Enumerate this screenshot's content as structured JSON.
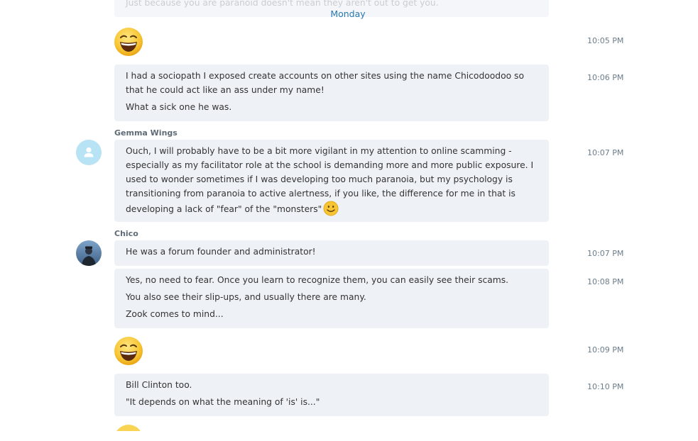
{
  "conversation": {
    "top_cut_message": "Just because you are paranoid doesn't mean they aren't out to get you.",
    "date_separator": "Monday",
    "messages": [
      {
        "sender": "",
        "type": "emoticon",
        "emoticon": "laugh-emoji",
        "time": "10:05 PM"
      },
      {
        "sender": "",
        "type": "text",
        "lines": [
          "I had a sociopath I exposed create accounts on other sites using the name Chicodoodoo so that he could act like an ass under my name!",
          "What a sick one he was."
        ],
        "time": "10:06 PM"
      },
      {
        "sender": "Gemma Wings",
        "avatar": "default-user-avatar",
        "type": "text",
        "lines": [
          "Ouch, I will probably have to be a bit more vigilant in my attention to online scamming - especially as my facilitator role at the school is demanding more and more public exposure.  I used to wonder sometimes if I was developing too much paranoia, but my psychology is transitioning from paranoia to active alertness, if you like, the difference for me in that is developing a lack of \"fear\" of the \"monsters\""
        ],
        "trailing_emoticon": "smile-emoji",
        "time": "10:07 PM"
      },
      {
        "sender": "Chico",
        "avatar": "chico-photo-avatar",
        "type": "text",
        "lines": [
          "He was a forum founder and administrator!"
        ],
        "time": "10:07 PM"
      },
      {
        "sender": "",
        "type": "text",
        "lines": [
          "Yes, no need to fear.  Once you learn to recognize them, you can easily see their scams.",
          "You also see their slip-ups, and usually there are many.",
          "Zook comes to mind..."
        ],
        "time": "10:08 PM"
      },
      {
        "sender": "",
        "type": "emoticon",
        "emoticon": "laugh-emoji",
        "time": "10:09 PM"
      },
      {
        "sender": "",
        "type": "text",
        "lines": [
          "Bill Clinton too.",
          "\"It depends on what the meaning of 'is' is...\""
        ],
        "time": "10:10 PM"
      }
    ]
  },
  "colors": {
    "bubble_bg": "#eef2f7",
    "timestamp": "#6b7d8c",
    "date_separator": "#2a7ab0",
    "default_avatar": "#b8e3f5",
    "emoji_yellow": "#f7c533"
  }
}
